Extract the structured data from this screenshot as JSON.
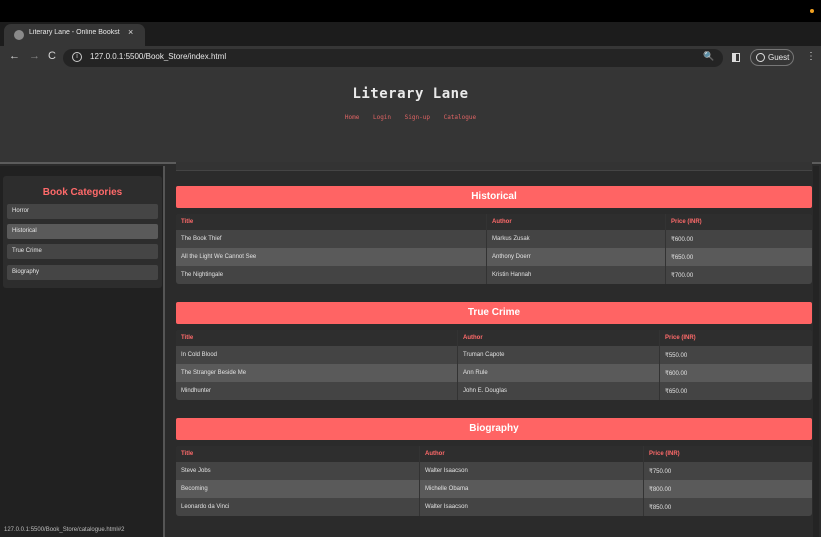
{
  "browser": {
    "tab_title": "Literary Lane - Online Bookst",
    "tab_close": "×",
    "new_tab": "+",
    "tab_search": "⌄",
    "back": "←",
    "forward": "→",
    "reload": "C",
    "url": "127.0.0.1:5500/Book_Store/index.html",
    "zoom_glyph": "🔍",
    "guest_label": "Guest",
    "menu": "⋮"
  },
  "site": {
    "title": "Literary Lane",
    "nav": [
      "Home",
      "Login",
      "Sign-up",
      "Catalogue"
    ]
  },
  "sidebar": {
    "title": "Book Categories",
    "items": [
      {
        "label": "Horror"
      },
      {
        "label": "Historical"
      },
      {
        "label": "True Crime"
      },
      {
        "label": "Biography"
      }
    ]
  },
  "status_url": "127.0.0.1:5500/Book_Store/catalogue.html#2",
  "sections": [
    {
      "heading": "Historical",
      "columns": [
        "Title",
        "Author",
        "Price (INR)"
      ],
      "rows": [
        [
          "The Book Thief",
          "Markus Zusak",
          "₹600.00"
        ],
        [
          "All the Light We Cannot See",
          "Anthony Doerr",
          "₹650.00"
        ],
        [
          "The Nightingale",
          "Kristin Hannah",
          "₹700.00"
        ]
      ]
    },
    {
      "heading": "True Crime",
      "columns": [
        "Title",
        "Author",
        "Price (INR)"
      ],
      "rows": [
        [
          "In Cold Blood",
          "Truman Capote",
          "₹550.00"
        ],
        [
          "The Stranger Beside Me",
          "Ann Rule",
          "₹600.00"
        ],
        [
          "Mindhunter",
          "John E. Douglas",
          "₹650.00"
        ]
      ]
    },
    {
      "heading": "Biography",
      "columns": [
        "Title",
        "Author",
        "Price (INR)"
      ],
      "rows": [
        [
          "Steve Jobs",
          "Walter Isaacson",
          "₹750.00"
        ],
        [
          "Becoming",
          "Michelle Obama",
          "₹800.00"
        ],
        [
          "Leonardo da Vinci",
          "Walter Isaacson",
          "₹850.00"
        ]
      ]
    }
  ],
  "colors": {
    "accent": "#ff6464",
    "page_bg": "#2b2b2b",
    "header_bg": "#353535",
    "sidebar_bg": "#212121"
  }
}
